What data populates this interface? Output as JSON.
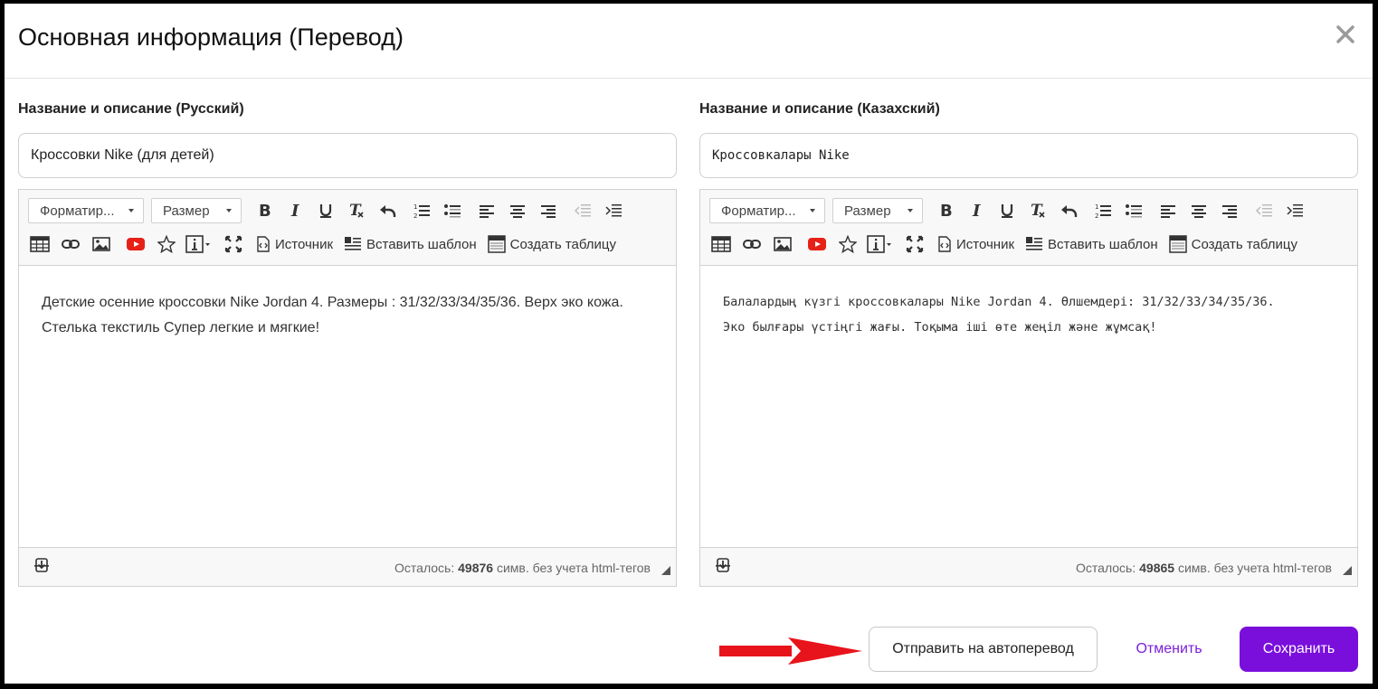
{
  "dialog": {
    "title": "Основная информация (Перевод)",
    "close_icon": "close-icon"
  },
  "left": {
    "label": "Название и описание (Русский)",
    "title_value": "Кроссовки Nike (для детей)",
    "toolbar": {
      "format_label": "Форматир...",
      "size_label": "Размер",
      "source_label": "Источник",
      "template_label": "Вставить шаблон",
      "table_label": "Создать таблицу"
    },
    "body_line1": "Детские осенние кроссовки Nike Jordan 4. Размеры : 31/32/33/34/35/36. Верх эко кожа.",
    "body_line2": "Стелька текстиль Супер легкие и мягкие!",
    "footer": {
      "prefix": "Осталось: ",
      "count": "49876",
      "suffix": " симв. без учета html-тегов"
    }
  },
  "right": {
    "label": "Название и описание (Казахский)",
    "title_value": "Кроссовкалары Nike",
    "toolbar": {
      "format_label": "Форматир...",
      "size_label": "Размер",
      "source_label": "Источник",
      "template_label": "Вставить шаблон",
      "table_label": "Создать таблицу"
    },
    "body_line1": "Балалардың күзгі кроссовкалары Nike Jordan 4. Өлшемдері: 31/32/33/34/35/36.",
    "body_line2": "Эко былғары үстіңгі жағы. Тоқыма іші өте жеңіл және жұмсақ!",
    "footer": {
      "prefix": "Осталось: ",
      "count": "49865",
      "suffix": " симв. без учета html-тегов"
    }
  },
  "actions": {
    "autotranslate_label": "Отправить на автоперевод",
    "cancel_label": "Отменить",
    "save_label": "Сохранить"
  },
  "colors": {
    "accent": "#7a0fdc",
    "annotation_arrow": "#e8141b",
    "youtube_red": "#e62117"
  }
}
